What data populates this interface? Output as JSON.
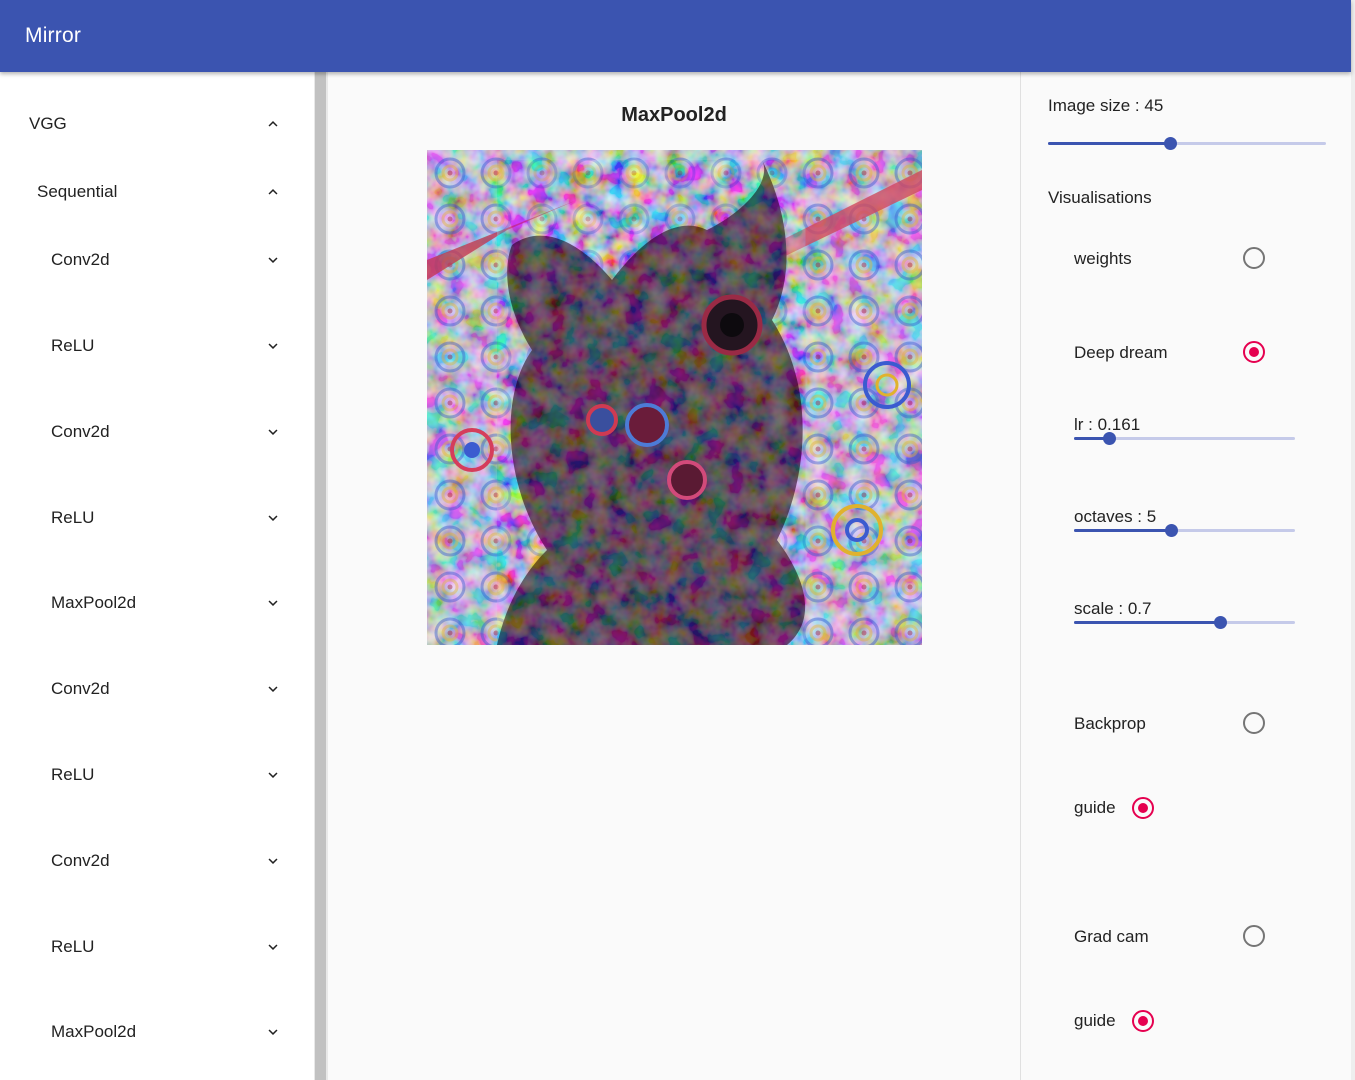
{
  "app": {
    "title": "Mirror"
  },
  "tree": [
    {
      "label": "VGG",
      "expanded": true
    },
    {
      "label": "Sequential",
      "expanded": true
    },
    {
      "label": "Conv2d",
      "expanded": false
    },
    {
      "label": "ReLU",
      "expanded": false
    },
    {
      "label": "Conv2d",
      "expanded": false
    },
    {
      "label": "ReLU",
      "expanded": false
    },
    {
      "label": "MaxPool2d",
      "expanded": false
    },
    {
      "label": "Conv2d",
      "expanded": false
    },
    {
      "label": "ReLU",
      "expanded": false
    },
    {
      "label": "Conv2d",
      "expanded": false
    },
    {
      "label": "ReLU",
      "expanded": false
    },
    {
      "label": "MaxPool2d",
      "expanded": false
    }
  ],
  "main": {
    "layer_title": "MaxPool2d"
  },
  "settings": {
    "image_size_label": "Image size : 45",
    "image_size_fraction": 0.44,
    "visualisations_label": "Visualisations",
    "weights": {
      "label": "weights",
      "selected": false
    },
    "deep_dream": {
      "label": "Deep dream",
      "selected": true,
      "lr_label": "lr : 0.161",
      "lr_fraction": 0.16,
      "octaves_label": "octaves : 5",
      "octaves_fraction": 0.44,
      "scale_label": "scale : 0.7",
      "scale_fraction": 0.66
    },
    "backprop": {
      "label": "Backprop",
      "selected": false,
      "guide_label": "guide",
      "guide_selected": true
    },
    "grad_cam": {
      "label": "Grad cam",
      "selected": false,
      "guide_label": "guide",
      "guide_selected": true
    }
  },
  "colors": {
    "primary": "#3b54b0",
    "accent": "#e5004f"
  }
}
